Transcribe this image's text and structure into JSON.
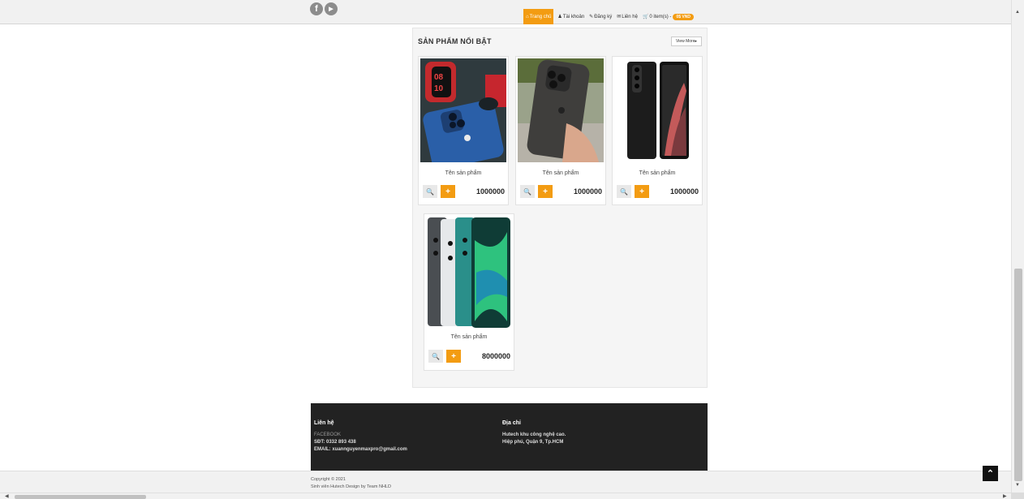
{
  "header": {
    "social": [
      {
        "icon": "facebook-icon",
        "glyph": "f"
      },
      {
        "icon": "youtube-icon",
        "glyph": "▶"
      }
    ],
    "nav": {
      "home": {
        "icon": "home-icon",
        "label": "Trang chủ"
      },
      "account": {
        "icon": "user-icon",
        "label": "Tài khoản"
      },
      "register": {
        "icon": "edit-icon",
        "label": "Đăng ký"
      },
      "contact": {
        "icon": "envelope-icon",
        "label": "Liên hệ"
      },
      "cart": {
        "icon": "cart-icon",
        "label": "0 item(s) -",
        "total": "0$ VND"
      }
    }
  },
  "featured": {
    "title": "SẢN PHẨM NỔI BẬT",
    "view_more": "View More",
    "products": [
      {
        "name": "Tên sản phẩm",
        "price": "1000000",
        "image": "blue-iphone-with-watch"
      },
      {
        "name": "Tên sản phẩm",
        "price": "1000000",
        "image": "graphite-iphone-in-hand"
      },
      {
        "name": "Tên sản phẩm",
        "price": "1000000",
        "image": "black-samsung-s21-ultra"
      },
      {
        "name": "Tên sản phẩm",
        "price": "8000000",
        "image": "xiaomi-note-10-three-colors"
      }
    ]
  },
  "footer": {
    "contact": {
      "heading": "Liên hệ",
      "facebook": "FACEBOOK",
      "phone": "SĐT: 0332 893 438",
      "email": "EMAIL: xuannguyenmaxpro@gmail.com"
    },
    "address": {
      "heading": "Địa chỉ",
      "line1": "Hutech khu công nghệ cao.",
      "line2": "Hiệp phú, Quận 9, Tp.HCM"
    },
    "copyright": "Copyright © 2021",
    "credit": "Sinh viên Hutech Design by Team NHLD"
  },
  "colors": {
    "accent": "#f39c12",
    "footer_bg": "#222222",
    "panel_bg": "#f5f5f5"
  }
}
